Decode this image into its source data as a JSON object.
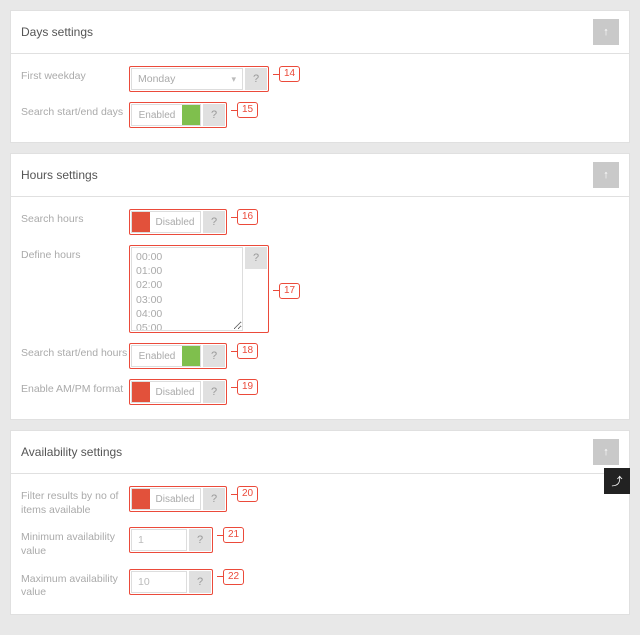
{
  "days": {
    "title": "Days settings",
    "first_weekday_label": "First weekday",
    "first_weekday_value": "Monday",
    "search_days_label": "Search start/end days",
    "search_days_state": "Enabled"
  },
  "hours": {
    "title": "Hours settings",
    "search_hours_label": "Search hours",
    "search_hours_state": "Disabled",
    "define_hours_label": "Define hours",
    "define_hours_options": [
      "00:00",
      "01:00",
      "02:00",
      "03:00",
      "04:00",
      "05:00"
    ],
    "search_hours_range_label": "Search start/end hours",
    "search_hours_range_state": "Enabled",
    "ampm_label": "Enable AM/PM format",
    "ampm_state": "Disabled"
  },
  "availability": {
    "title": "Availability settings",
    "filter_label": "Filter results by no of items available",
    "filter_state": "Disabled",
    "min_label": "Minimum availability value",
    "min_value": "1",
    "max_label": "Maximum availability value",
    "max_value": "10"
  },
  "callouts": {
    "c14": "14",
    "c15": "15",
    "c16": "16",
    "c17": "17",
    "c18": "18",
    "c19": "19",
    "c20": "20",
    "c21": "21",
    "c22": "22"
  },
  "glyphs": {
    "help": "?",
    "up": "↑",
    "chevdown": "▾",
    "top": "⤴"
  }
}
